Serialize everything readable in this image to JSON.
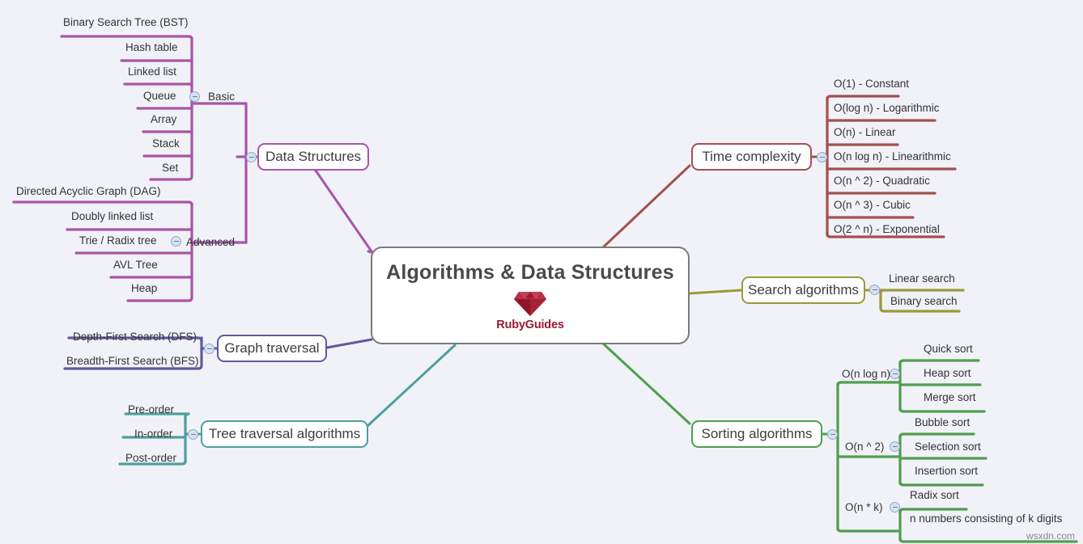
{
  "center": {
    "title": "Algorithms & Data Structures",
    "logo_text": "RubyGuides",
    "logo_icon": "ruby-gem-icon"
  },
  "watermark": "wsxdn.com",
  "colors": {
    "background": "#f1f2f8",
    "center_border": "#7a7a7a",
    "data_structures": "#a855a8",
    "time_complexity": "#a35050",
    "search_algorithms": "#9a9a3c",
    "sorting_algorithms": "#4f9e4f",
    "graph_traversal": "#5c5c9e",
    "tree_traversal": "#4f9e9e",
    "logo_text": "#9b1b30"
  },
  "branches": {
    "data_structures": {
      "label": "Data Structures",
      "groups": [
        {
          "label": "Basic",
          "leaves": [
            "Binary Search Tree (BST)",
            "Hash table",
            "Linked list",
            "Queue",
            "Array",
            "Stack",
            "Set"
          ]
        },
        {
          "label": "Advanced",
          "leaves": [
            "Directed Acyclic Graph (DAG)",
            "Doubly linked list",
            "Trie / Radix tree",
            "AVL Tree",
            "Heap"
          ]
        }
      ]
    },
    "time_complexity": {
      "label": "Time complexity",
      "leaves": [
        "O(1) - Constant",
        "O(log n) - Logarithmic",
        "O(n) - Linear",
        "O(n log n) - Linearithmic",
        "O(n ^ 2) - Quadratic",
        "O(n ^ 3) - Cubic",
        "O(2 ^ n) - Exponential"
      ]
    },
    "search_algorithms": {
      "label": "Search algorithms",
      "leaves": [
        "Linear search",
        "Binary search"
      ]
    },
    "sorting_algorithms": {
      "label": "Sorting algorithms",
      "groups": [
        {
          "label": "O(n log n)",
          "leaves": [
            "Quick sort",
            "Heap sort",
            "Merge sort"
          ]
        },
        {
          "label": "O(n ^ 2)",
          "leaves": [
            "Bubble sort",
            "Selection sort",
            "Insertion sort"
          ]
        },
        {
          "label": "O(n * k)",
          "leaves": [
            "Radix sort",
            "n numbers consisting of k digits"
          ]
        }
      ]
    },
    "graph_traversal": {
      "label": "Graph traversal",
      "leaves": [
        "Depth-First Search (DFS)",
        "Breadth-First Search (BFS)"
      ]
    },
    "tree_traversal": {
      "label": "Tree traversal algorithms",
      "leaves": [
        "Pre-order",
        "In-order",
        "Post-order"
      ]
    }
  }
}
